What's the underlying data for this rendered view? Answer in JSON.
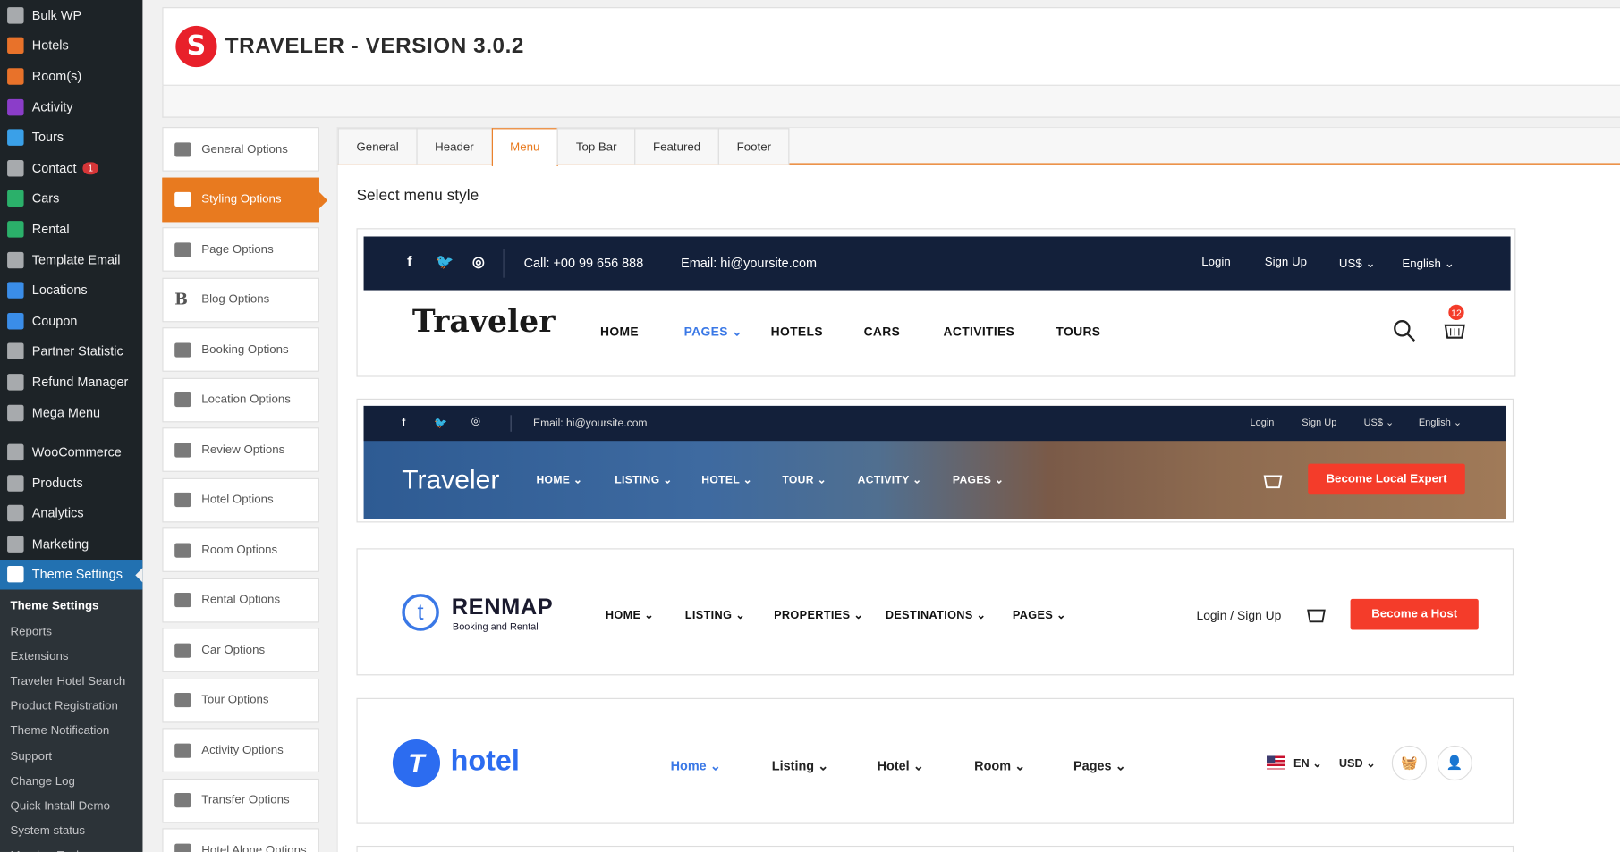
{
  "sidebar": {
    "items": [
      {
        "label": "Bulk WP",
        "icon": "bulk-icon",
        "color": "#a7aaad"
      },
      {
        "label": "Hotels",
        "icon": "hotel-icon",
        "color": "#e8722a"
      },
      {
        "label": "Room(s)",
        "icon": "room-icon",
        "color": "#e8722a"
      },
      {
        "label": "Activity",
        "icon": "activity-icon",
        "color": "#8b3dc9"
      },
      {
        "label": "Tours",
        "icon": "tours-icon",
        "color": "#3aa0e8"
      },
      {
        "label": "Contact",
        "icon": "mail-icon",
        "color": "#a7aaad",
        "badge": "1"
      },
      {
        "label": "Cars",
        "icon": "car-icon",
        "color": "#2bb06a"
      },
      {
        "label": "Rental",
        "icon": "home-icon",
        "color": "#2bb06a"
      },
      {
        "label": "Template Email",
        "icon": "mail-icon",
        "color": "#a7aaad"
      },
      {
        "label": "Locations",
        "icon": "location-icon",
        "color": "#3a8de8"
      },
      {
        "label": "Coupon",
        "icon": "coupon-icon",
        "color": "#3a8de8"
      },
      {
        "label": "Partner Statistic",
        "icon": "user-icon",
        "color": "#a7aaad"
      },
      {
        "label": "Refund Manager",
        "icon": "shuffle-icon",
        "color": "#a7aaad"
      },
      {
        "label": "Mega Menu",
        "icon": "menu-icon",
        "color": "#a7aaad"
      }
    ],
    "items2": [
      {
        "label": "WooCommerce",
        "icon": "woo-icon",
        "color": "#a7aaad"
      },
      {
        "label": "Products",
        "icon": "products-icon",
        "color": "#a7aaad"
      },
      {
        "label": "Analytics",
        "icon": "analytics-icon",
        "color": "#a7aaad"
      },
      {
        "label": "Marketing",
        "icon": "megaphone-icon",
        "color": "#a7aaad"
      },
      {
        "label": "Theme Settings",
        "icon": "settings-icon",
        "color": "#ffffff"
      }
    ],
    "sub": [
      "Theme Settings",
      "Reports",
      "Extensions",
      "Traveler Hotel Search",
      "Product Registration",
      "Theme Notification",
      "Support",
      "Change Log",
      "Quick Install Demo",
      "System status",
      "Member Tools"
    ]
  },
  "header": {
    "title": "TRAVELER - VERSION 3.0.2",
    "logo_letter": "S",
    "brand_color": "#e8202a"
  },
  "options": [
    {
      "label": "General Options",
      "icon": "dashboard-icon"
    },
    {
      "label": "Styling Options",
      "icon": "brush-icon"
    },
    {
      "label": "Page Options",
      "icon": "page-icon"
    },
    {
      "label": "Blog Options",
      "icon": "blog-icon"
    },
    {
      "label": "Booking Options",
      "icon": "book-icon"
    },
    {
      "label": "Location Options",
      "icon": "location-arrow-icon"
    },
    {
      "label": "Review Options",
      "icon": "comments-icon"
    },
    {
      "label": "Hotel Options",
      "icon": "building-icon"
    },
    {
      "label": "Room Options",
      "icon": "building-icon"
    },
    {
      "label": "Rental Options",
      "icon": "home-icon"
    },
    {
      "label": "Car Options",
      "icon": "car-icon"
    },
    {
      "label": "Tour Options",
      "icon": "suitcase-icon"
    },
    {
      "label": "Activity Options",
      "icon": "ticket-icon"
    },
    {
      "label": "Transfer Options",
      "icon": "car-icon"
    },
    {
      "label": "Hotel Alone Options",
      "icon": "building-icon"
    }
  ],
  "tabs": [
    "General",
    "Header",
    "Menu",
    "Top Bar",
    "Featured",
    "Footer"
  ],
  "accent_color": "#e87a1f",
  "section_title": "Select menu style",
  "style1": {
    "phone": "Call: +00 99 656 888",
    "email": "Email: hi@yoursite.com",
    "login": "Login",
    "signup": "Sign Up",
    "currency": "US$",
    "language": "English",
    "logo": "Traveler",
    "nav": [
      "HOME",
      "PAGES",
      "HOTELS",
      "CARS",
      "ACTIVITIES",
      "TOURS"
    ],
    "cart_count": "12"
  },
  "style2": {
    "email": "Email: hi@yoursite.com",
    "login": "Login",
    "signup": "Sign Up",
    "currency": "US$",
    "language": "English",
    "logo": "Traveler",
    "nav": [
      "HOME",
      "LISTING",
      "HOTEL",
      "TOUR",
      "ACTIVITY",
      "PAGES"
    ],
    "button": "Become Local Expert"
  },
  "style3": {
    "logo": "RENMAP",
    "tagline": "Booking and Rental",
    "logo_letter": "t",
    "nav": [
      "HOME",
      "LISTING",
      "PROPERTIES",
      "DESTINATIONS",
      "PAGES"
    ],
    "login": "Login",
    "separator": "/",
    "signup": "Sign Up",
    "button": "Become a Host"
  },
  "style4": {
    "logo": "hotel",
    "logo_letter": "T",
    "nav": [
      "Home",
      "Listing",
      "Hotel",
      "Room",
      "Pages"
    ],
    "lang": "EN",
    "currency": "USD"
  }
}
